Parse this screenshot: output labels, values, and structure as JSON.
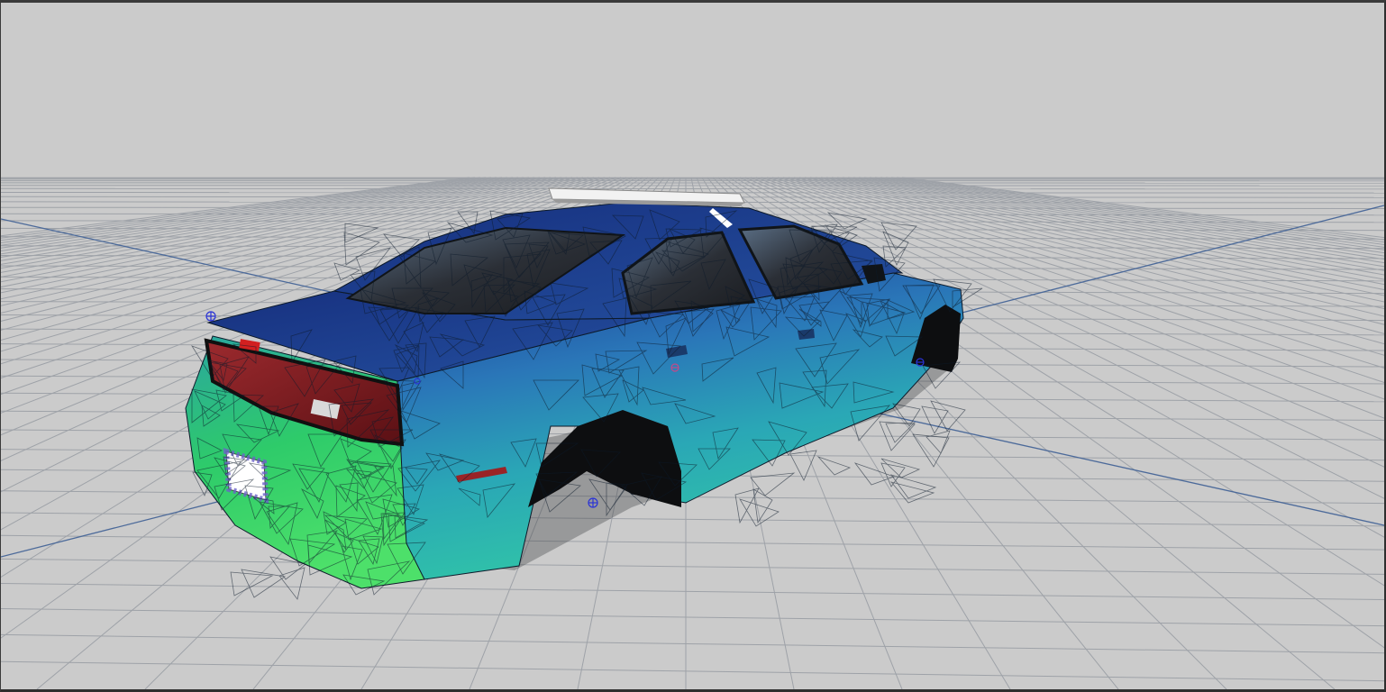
{
  "viewport": {
    "background_color": "#cccccc",
    "grid_color": "#9ea2a8",
    "axis_color": "#4c6a9a",
    "view_mode": "textured-wireframe"
  },
  "model": {
    "icon": "police-sedan-3d-model",
    "gradient_colors": [
      "#1f3f9a",
      "#2f8fc0",
      "#29b8b3",
      "#2fd06a"
    ],
    "taillight_color": "#8b1a1f",
    "lightbar_color": "#e8e8e8",
    "wireframe_color": "#0d1a2a"
  },
  "gizmos": {
    "icon": "bone-joint-gizmo",
    "color": "#2a33d6"
  }
}
